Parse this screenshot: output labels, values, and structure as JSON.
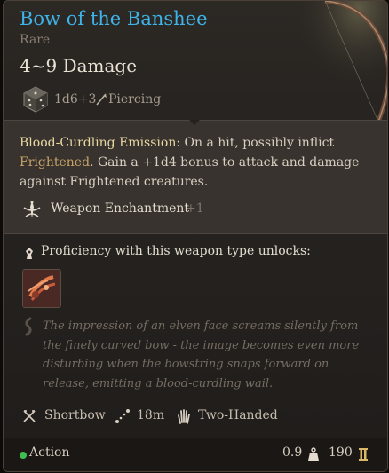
{
  "item": {
    "name": "Bow of the Banshee",
    "rarity": "Rare",
    "damage": "4~9 Damage",
    "dice_formula": "1d6+3",
    "damage_type": "Piercing"
  },
  "description": {
    "keyword": "Blood-Curdling Emission:",
    "part1": " On a hit, possibly inflict ",
    "condition": "Frightened",
    "part2": ". Gain a +1d4 bonus to attack and damage against Frightened creatures."
  },
  "enchantment": {
    "label": "Weapon Enchantment",
    "bonus": "+1"
  },
  "proficiency": {
    "label": "Proficiency with this weapon type unlocks:"
  },
  "flavor": "The impression of an elven face screams silently from the finely curved bow - the image becomes even more disturbing when the bowstring snaps forward on release, emitting a blood-curdling wail.",
  "properties": {
    "type": "Shortbow",
    "range": "18m",
    "handedness": "Two-Handed"
  },
  "footer": {
    "action": "Action",
    "weight": "0.9",
    "value": "190"
  },
  "colors": {
    "rarity_title": "#3fb4e8",
    "keyword": "#ead9a3",
    "condition": "#c9a468",
    "action_dot": "#3fbf4f"
  },
  "icons": [
    "dice-icon",
    "piercing-icon",
    "enchantment-icon",
    "proficiency-icon",
    "action-card-icon",
    "flavor-icon",
    "shortbow-icon",
    "range-icon",
    "two-handed-icon",
    "weight-icon",
    "gold-coin-icon"
  ]
}
